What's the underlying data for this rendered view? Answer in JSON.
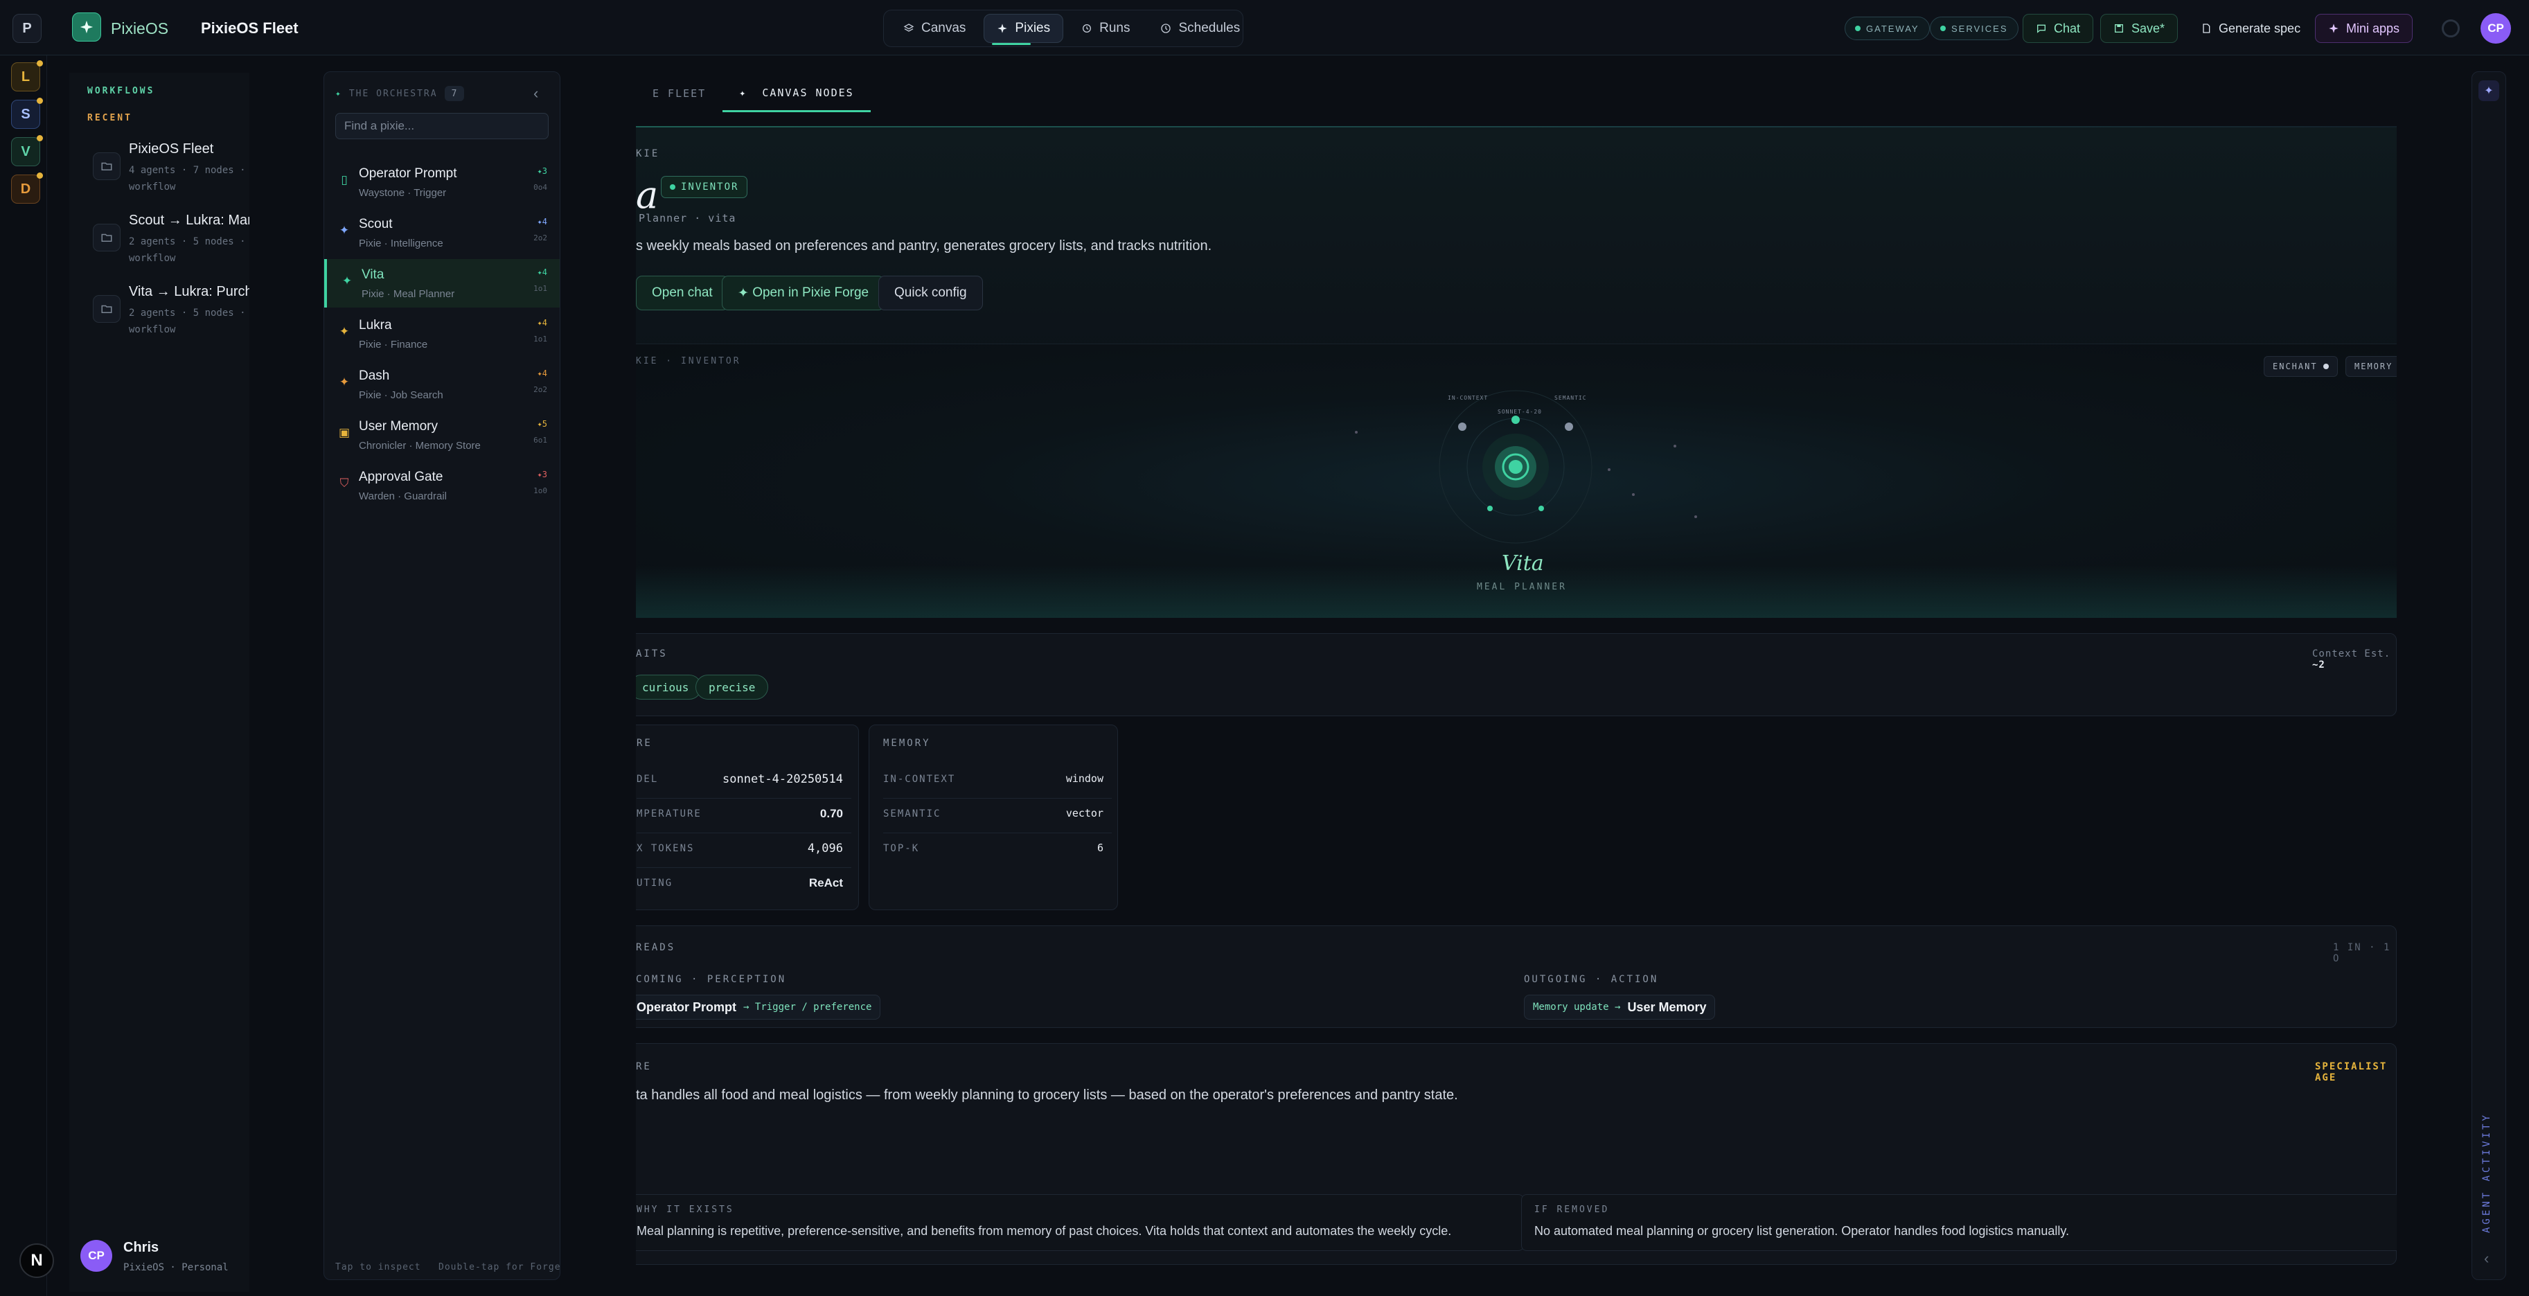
{
  "workspace_letter": "P",
  "brand": "PixieOS",
  "fleet_name": "PixieOS Fleet",
  "nav": [
    {
      "label": "Canvas",
      "icon": "canvas-icon"
    },
    {
      "label": "Pixies",
      "icon": "sparkle-icon",
      "active": true
    },
    {
      "label": "Runs",
      "icon": "history-icon"
    },
    {
      "label": "Schedules",
      "icon": "clock-icon"
    }
  ],
  "status": {
    "gateway": "GATEWAY",
    "services": "SERVICES"
  },
  "actions": {
    "chat": "Chat",
    "save": "Save*",
    "generate": "Generate spec",
    "mini_apps": "Mini apps"
  },
  "user_initials": "CP",
  "rail": [
    {
      "letter": "L",
      "color": "#e6b43c"
    },
    {
      "letter": "S",
      "color": "#7fa8ff"
    },
    {
      "letter": "V",
      "color": "#5fd3a8"
    },
    {
      "letter": "D",
      "color": "#e69a3c"
    }
  ],
  "workflows": {
    "heading": "WORKFLOWS",
    "recent": "RECENT",
    "items": [
      {
        "title": "PixieOS Fleet",
        "sub": "4 agents · 7 nodes · workflow"
      },
      {
        "title": "Scout → Lukra: Mark",
        "sub": "2 agents · 5 nodes · workflow"
      },
      {
        "title": "Vita → Lukra: Purcha",
        "sub": "2 agents · 5 nodes · workflow"
      }
    ]
  },
  "user": {
    "initials": "CP",
    "name": "Chris",
    "workspace": "PixieOS · Personal"
  },
  "orchestra": {
    "heading": "THE ORCHESTRA",
    "count": "7",
    "search_placeholder": "Find a pixie...",
    "footer_left": "Tap to inspect",
    "footer_right": "Double-tap for Forge",
    "items": [
      {
        "name": "Operator Prompt",
        "sub": "Waystone · Trigger",
        "rank": "3",
        "meta": "0o4"
      },
      {
        "name": "Scout",
        "sub": "Pixie · Intelligence",
        "rank": "4",
        "meta": "2o2"
      },
      {
        "name": "Vita",
        "sub": "Pixie · Meal Planner",
        "rank": "4",
        "meta": "1o1",
        "selected": true
      },
      {
        "name": "Lukra",
        "sub": "Pixie · Finance",
        "rank": "4",
        "meta": "1o1"
      },
      {
        "name": "Dash",
        "sub": "Pixie · Job Search",
        "rank": "4",
        "meta": "2o2"
      },
      {
        "name": "User Memory",
        "sub": "Chronicler · Memory Store",
        "rank": "5",
        "meta": "6o1"
      },
      {
        "name": "Approval Gate",
        "sub": "Warden · Guardrail",
        "rank": "3",
        "meta": "1o0"
      }
    ]
  },
  "tabs": {
    "fleet": "E FLEET",
    "canvas_nodes": "CANVAS NODES"
  },
  "hero": {
    "label": "KIE",
    "title": "a",
    "badge": "INVENTOR",
    "meta": "Planner · vita",
    "desc": "s weekly meals based on preferences and pantry, generates grocery lists, and tracks nutrition.",
    "btn_chat": "Open chat",
    "btn_forge": "Open in Pixie Forge",
    "btn_config": "Quick config"
  },
  "viz": {
    "label": "KIE · INVENTOR",
    "tag_enchant": "ENCHANT",
    "tag_memory": "MEMORY",
    "node_incontext": "IN-CONTEXT",
    "node_sonnet": "SONNET-4-20",
    "node_semantic": "SEMANTIC",
    "name": "Vita",
    "role": "MEAL PLANNER"
  },
  "traits": {
    "title": "AITS",
    "context_label": "Context Est.",
    "context_value": "~2",
    "items": [
      "curious",
      "precise"
    ]
  },
  "core": {
    "title": "RE",
    "rows": [
      {
        "k": "DEL",
        "v": "sonnet-4-20250514"
      },
      {
        "k": "MPERATURE",
        "v": "0.70"
      },
      {
        "k": "X TOKENS",
        "v": "4,096"
      },
      {
        "k": "UTING",
        "v": "ReAct"
      }
    ]
  },
  "memory": {
    "title": "MEMORY",
    "rows": [
      {
        "k": "IN-CONTEXT",
        "v": "window"
      },
      {
        "k": "SEMANTIC",
        "v": "vector"
      },
      {
        "k": "TOP-K",
        "v": "6"
      }
    ]
  },
  "threads": {
    "title": "READS",
    "count": "1 IN · 1 O",
    "incoming_label": "COMING · PERCEPTION",
    "incoming_name": "Operator Prompt",
    "incoming_rel": "→ Trigger / preference",
    "outgoing_label": "OUTGOING · ACTION",
    "outgoing_rel": "Memory update →",
    "outgoing_name": "User Memory"
  },
  "role": {
    "title": "RE",
    "tag": "SPECIALIST AGE",
    "desc": "ta handles all food and meal logistics — from weekly planning to grocery lists — based on the operator's preferences and pantry state.",
    "why_title": "WHY IT EXISTS",
    "why_desc": "Meal planning is repetitive, preference-sensitive, and benefits from memory of past choices. Vita holds that context and automates the weekly cycle.",
    "removed_title": "IF REMOVED",
    "removed_desc": "No automated meal planning or grocery list generation. Operator handles food logistics manually."
  },
  "activity": {
    "label": "AGENT ACTIVITY"
  },
  "colors": {
    "accent": "#3fd3a2",
    "purple": "#8a5cf6",
    "amber": "#e6b43c"
  }
}
